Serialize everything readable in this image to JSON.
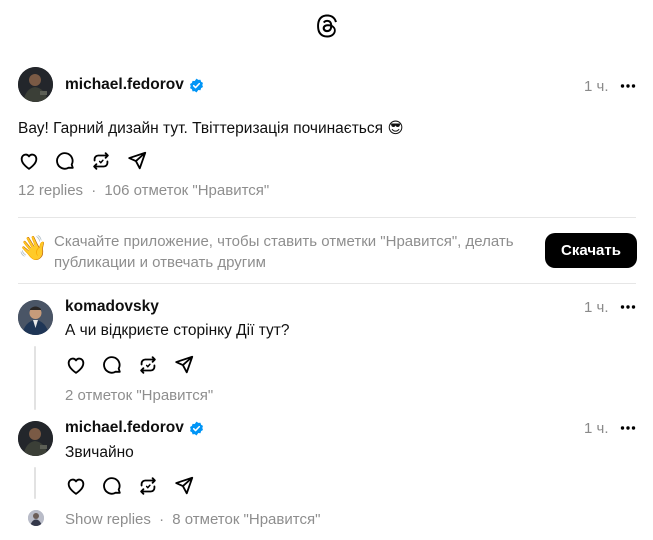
{
  "header": {
    "logo_icon": "threads-logo-icon"
  },
  "main_post": {
    "username": "michael.fedorov",
    "verified": true,
    "time": "1 ч.",
    "text": "Вау! Гарний дизайн тут. Твіттеризація починається 😎",
    "replies": "12 replies",
    "separator": "·",
    "likes": "106 отметок \"Нравится\""
  },
  "banner": {
    "emoji": "👋",
    "text": "Скачайте приложение, чтобы ставить отметки \"Нравится\", делать публикации и отвечать другим",
    "button_label": "Скачать"
  },
  "replies": [
    {
      "username": "komadovsky",
      "verified": false,
      "time": "1 ч.",
      "text": "А чи відкриєте сторінку Дії тут?",
      "likes": "2 отметок \"Нравится\""
    },
    {
      "username": "michael.fedorov",
      "verified": true,
      "time": "1 ч.",
      "text": "Звичайно",
      "show_replies": "Show replies",
      "separator": "·",
      "likes": "8 отметок \"Нравится\""
    }
  ],
  "colors": {
    "verified": "#0095f6",
    "muted": "#8e8e8e",
    "button_bg": "#000000"
  },
  "icons": [
    "heart-icon",
    "comment-icon",
    "repost-icon",
    "share-icon",
    "more-icon",
    "verified-badge-icon"
  ]
}
